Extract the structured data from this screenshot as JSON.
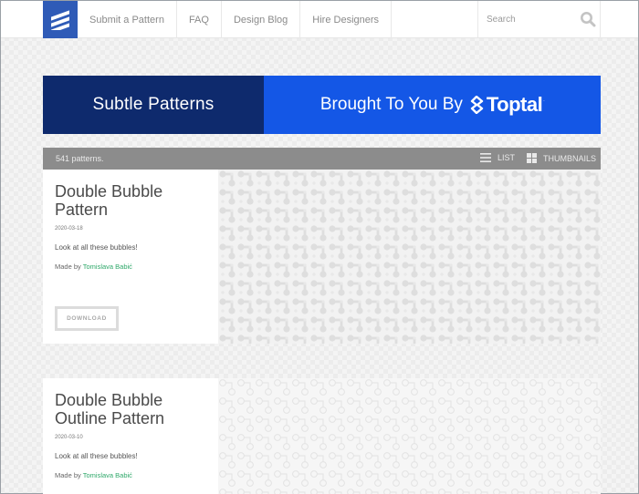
{
  "nav": {
    "items": [
      "Submit a Pattern",
      "FAQ",
      "Design Blog",
      "Hire Designers"
    ],
    "search_placeholder": "Search"
  },
  "banner": {
    "left_text": "Subtle Patterns",
    "right_text": "Brought To You By",
    "brand": "Toptal",
    "brand_mark": ".",
    "colors": {
      "left": "#0e2a6d",
      "right": "#1457e6"
    }
  },
  "listbar": {
    "count_text": "541 patterns.",
    "list_label": "LIST",
    "thumbnails_label": "THUMBNAILS"
  },
  "patterns": [
    {
      "title_line1": "Double Bubble",
      "title_line2": "Pattern",
      "date": "2020-03-18",
      "description": "Look at all these bubbles!",
      "made_by_prefix": "Made by",
      "author": "Tomislava Babić",
      "download_label": "DOWNLOAD"
    },
    {
      "title_line1": "Double Bubble",
      "title_line2": "Outline Pattern",
      "date": "2020-03-10",
      "description": "Look at all these bubbles!",
      "made_by_prefix": "Made by",
      "author": "Tomislava Babić"
    }
  ],
  "icons": {
    "logo": "subtle-patterns-logo-icon",
    "search": "search-icon",
    "list": "list-icon",
    "thumbnails": "grid-icon",
    "brand": "toptal-logo-icon"
  },
  "colors": {
    "accent_link": "#2fa86a",
    "logo_bg": "#2f5bb7"
  }
}
